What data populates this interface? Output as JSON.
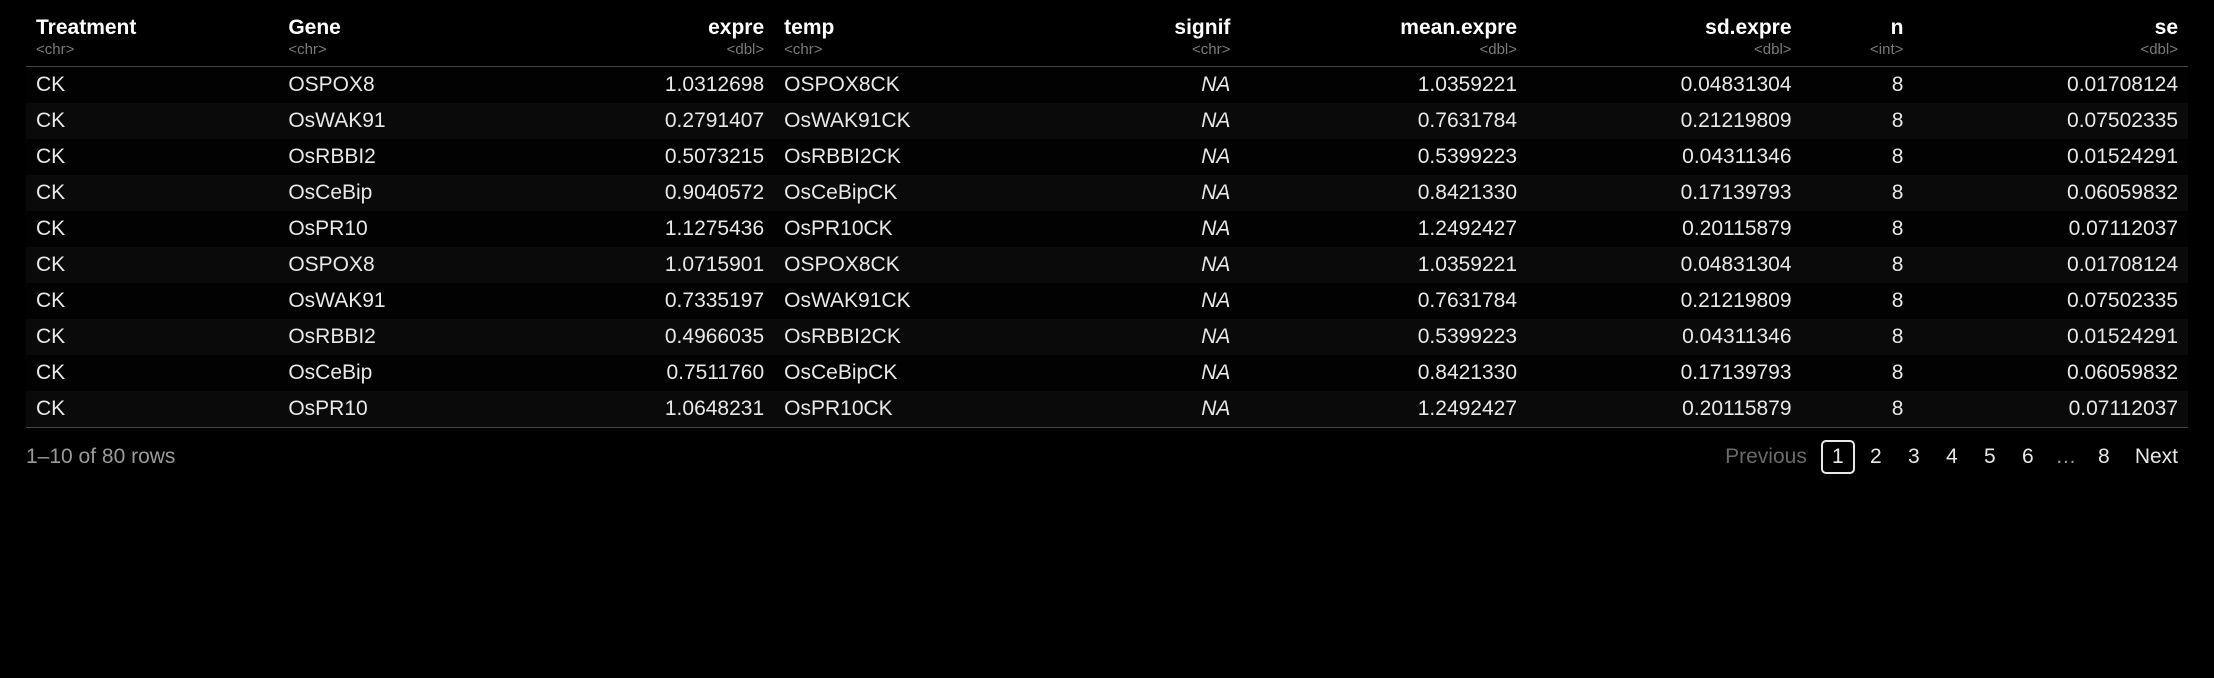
{
  "columns": [
    {
      "name": "Treatment",
      "type": "<chr>",
      "align": "left"
    },
    {
      "name": "Gene",
      "type": "<chr>",
      "align": "left"
    },
    {
      "name": "expre",
      "type": "<dbl>",
      "align": "right"
    },
    {
      "name": "temp",
      "type": "<chr>",
      "align": "left"
    },
    {
      "name": "signif",
      "type": "<chr>",
      "align": "right"
    },
    {
      "name": "mean.expre",
      "type": "<dbl>",
      "align": "right"
    },
    {
      "name": "sd.expre",
      "type": "<dbl>",
      "align": "right"
    },
    {
      "name": "n",
      "type": "<int>",
      "align": "right"
    },
    {
      "name": "se",
      "type": "<dbl>",
      "align": "right"
    }
  ],
  "rows": [
    [
      "CK",
      "OSPOX8",
      "1.0312698",
      "OSPOX8CK",
      "NA",
      "1.0359221",
      "0.04831304",
      "8",
      "0.01708124"
    ],
    [
      "CK",
      "OsWAK91",
      "0.2791407",
      "OsWAK91CK",
      "NA",
      "0.7631784",
      "0.21219809",
      "8",
      "0.07502335"
    ],
    [
      "CK",
      "OsRBBI2",
      "0.5073215",
      "OsRBBI2CK",
      "NA",
      "0.5399223",
      "0.04311346",
      "8",
      "0.01524291"
    ],
    [
      "CK",
      "OsCeBip",
      "0.9040572",
      "OsCeBipCK",
      "NA",
      "0.8421330",
      "0.17139793",
      "8",
      "0.06059832"
    ],
    [
      "CK",
      "OsPR10",
      "1.1275436",
      "OsPR10CK",
      "NA",
      "1.2492427",
      "0.20115879",
      "8",
      "0.07112037"
    ],
    [
      "CK",
      "OSPOX8",
      "1.0715901",
      "OSPOX8CK",
      "NA",
      "1.0359221",
      "0.04831304",
      "8",
      "0.01708124"
    ],
    [
      "CK",
      "OsWAK91",
      "0.7335197",
      "OsWAK91CK",
      "NA",
      "0.7631784",
      "0.21219809",
      "8",
      "0.07502335"
    ],
    [
      "CK",
      "OsRBBI2",
      "0.4966035",
      "OsRBBI2CK",
      "NA",
      "0.5399223",
      "0.04311346",
      "8",
      "0.01524291"
    ],
    [
      "CK",
      "OsCeBip",
      "0.7511760",
      "OsCeBipCK",
      "NA",
      "0.8421330",
      "0.17139793",
      "8",
      "0.06059832"
    ],
    [
      "CK",
      "OsPR10",
      "1.0648231",
      "OsPR10CK",
      "NA",
      "1.2492427",
      "0.20115879",
      "8",
      "0.07112037"
    ]
  ],
  "footer": {
    "status": "1–10 of 80 rows",
    "prev_label": "Previous",
    "next_label": "Next",
    "pages": [
      "1",
      "2",
      "3",
      "4",
      "5",
      "6",
      "…",
      "8"
    ],
    "current_page": "1",
    "ellipsis": "…"
  }
}
